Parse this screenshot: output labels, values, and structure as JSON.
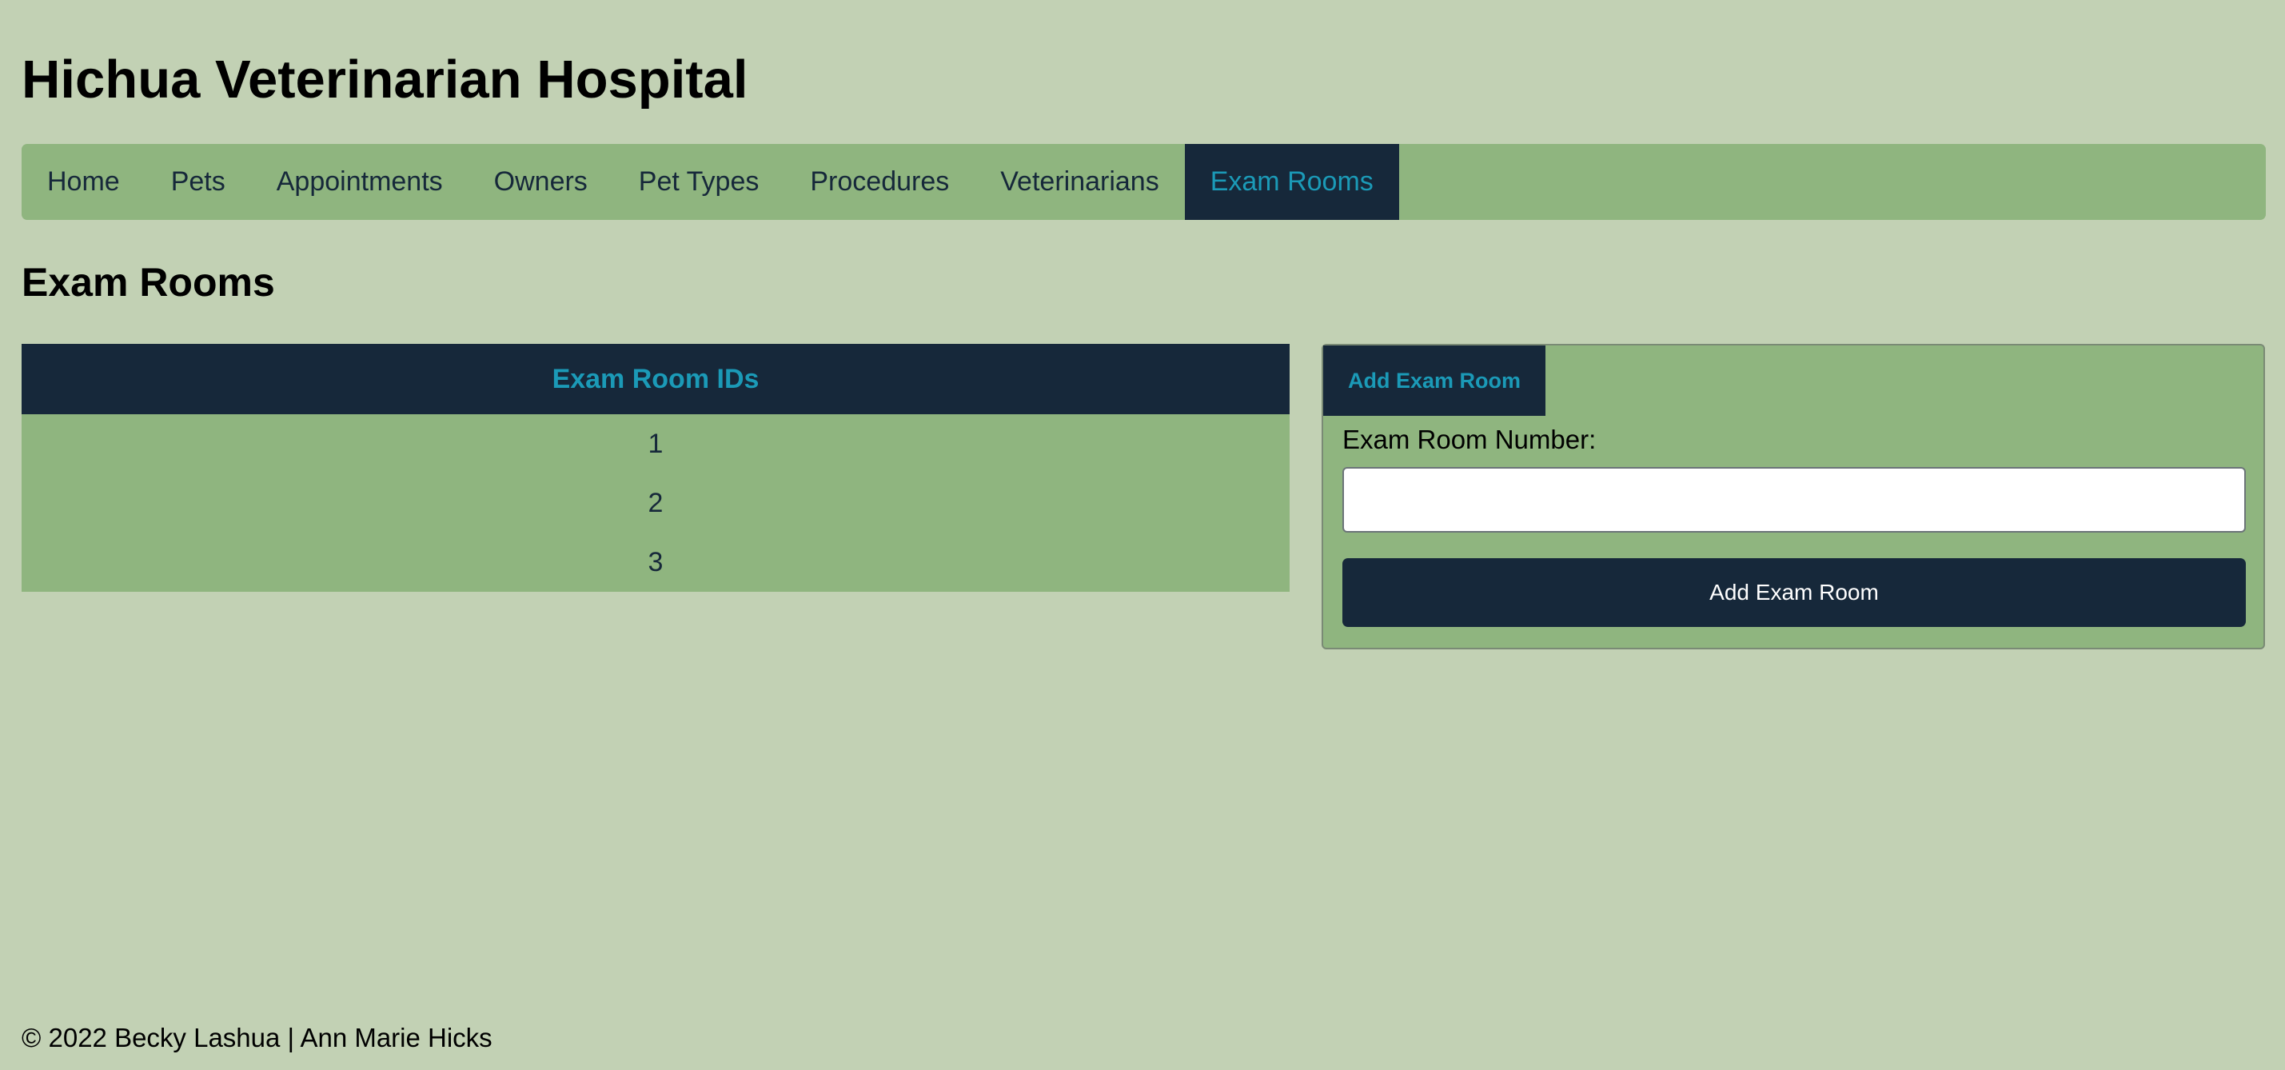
{
  "header": {
    "title": "Hichua Veterinarian Hospital"
  },
  "nav": {
    "items": [
      {
        "label": "Home",
        "active": false
      },
      {
        "label": "Pets",
        "active": false
      },
      {
        "label": "Appointments",
        "active": false
      },
      {
        "label": "Owners",
        "active": false
      },
      {
        "label": "Pet Types",
        "active": false
      },
      {
        "label": "Procedures",
        "active": false
      },
      {
        "label": "Veterinarians",
        "active": false
      },
      {
        "label": "Exam Rooms",
        "active": true
      }
    ]
  },
  "main": {
    "heading": "Exam Rooms",
    "table": {
      "header": "Exam Room IDs",
      "rows": [
        "1",
        "2",
        "3"
      ]
    },
    "form": {
      "tab_label": "Add Exam Room",
      "field_label": "Exam Room Number:",
      "input_value": "",
      "submit_label": "Add Exam Room"
    }
  },
  "footer": {
    "text": "© 2022 Becky Lashua | Ann Marie Hicks"
  },
  "colors": {
    "page_background": "#c2d1b4",
    "panel_green": "#8fb57f",
    "navy": "#16283a",
    "accent_teal": "#1b9ab7"
  }
}
